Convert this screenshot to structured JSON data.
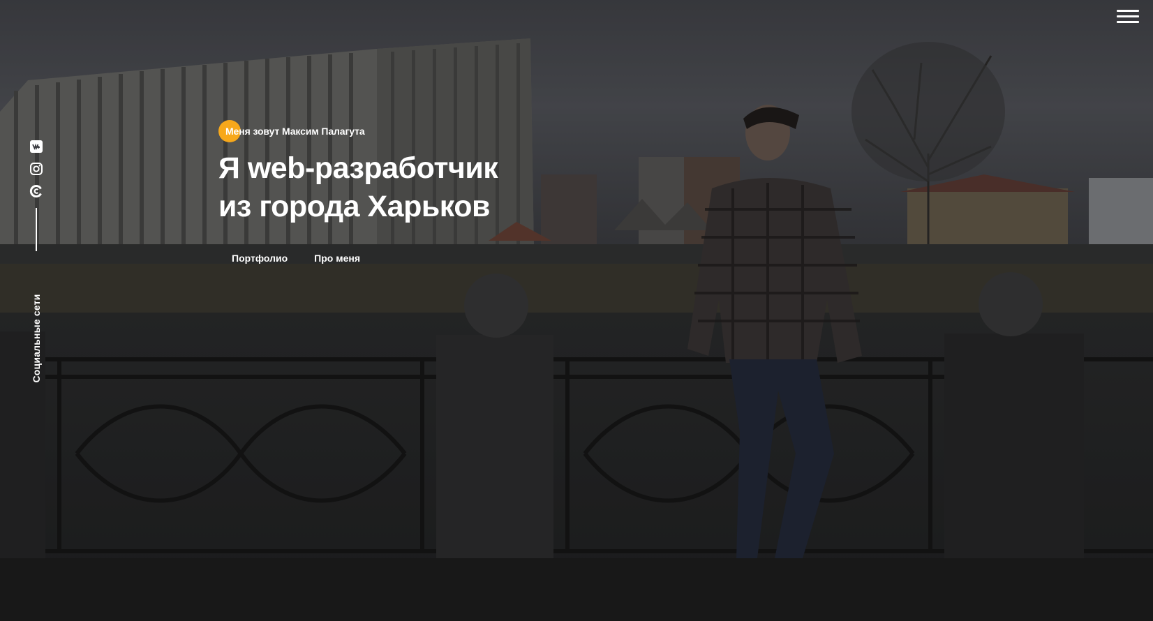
{
  "header": {
    "menu_icon": "hamburger-menu-icon"
  },
  "social": {
    "label": "Социальные сети",
    "icons": [
      "vk-icon",
      "instagram-icon",
      "github-icon"
    ]
  },
  "hero": {
    "eyebrow": "Меня зовут Максим Палагута",
    "headline_line1": "Я web-разработчик",
    "headline_line2": "из города Харьков",
    "links": {
      "portfolio": "Портфолио",
      "about": "Про меня"
    }
  },
  "colors": {
    "accent": "#f7a81b",
    "text": "#ffffff",
    "sky": "#4d4f56",
    "ground": "#1c1d20"
  }
}
